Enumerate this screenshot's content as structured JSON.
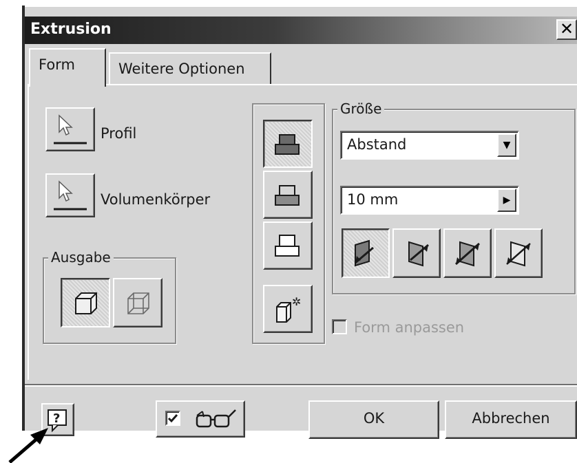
{
  "window": {
    "title": "Extrusion",
    "close_glyph": "✕"
  },
  "tabs": [
    {
      "label": "Form"
    },
    {
      "label": "Weitere Optionen"
    }
  ],
  "selectors": {
    "profile_label": "Profil",
    "solid_label": "Volumenkörper",
    "profile_icon": "cursor-select-icon",
    "solid_icon": "cursor-select-icon"
  },
  "output": {
    "title": "Ausgabe",
    "options": [
      {
        "name": "solid-output-icon",
        "selected": true
      },
      {
        "name": "surface-output-icon",
        "selected": false
      }
    ]
  },
  "operations": [
    {
      "name": "join-icon",
      "selected": true
    },
    {
      "name": "cut-icon",
      "selected": false
    },
    {
      "name": "intersect-icon",
      "selected": false
    },
    {
      "name": "new-solid-icon",
      "selected": false
    }
  ],
  "size": {
    "title": "Größe",
    "extent_value": "Abstand",
    "distance_value": "10 mm",
    "directions": [
      {
        "name": "direction-1-icon",
        "selected": true
      },
      {
        "name": "direction-2-icon",
        "selected": false
      },
      {
        "name": "symmetric-icon",
        "selected": false
      },
      {
        "name": "asymmetric-icon",
        "selected": false
      }
    ]
  },
  "match_shape": {
    "label": "Form anpassen",
    "checked": false,
    "enabled": false
  },
  "footer": {
    "help_glyph": "?",
    "preview_checked": true,
    "preview_icon": "glasses-icon",
    "ok_label": "OK",
    "cancel_label": "Abbrechen"
  },
  "colors": {
    "title_dark": "#1c1c1c",
    "face": "#d6d6d6"
  }
}
